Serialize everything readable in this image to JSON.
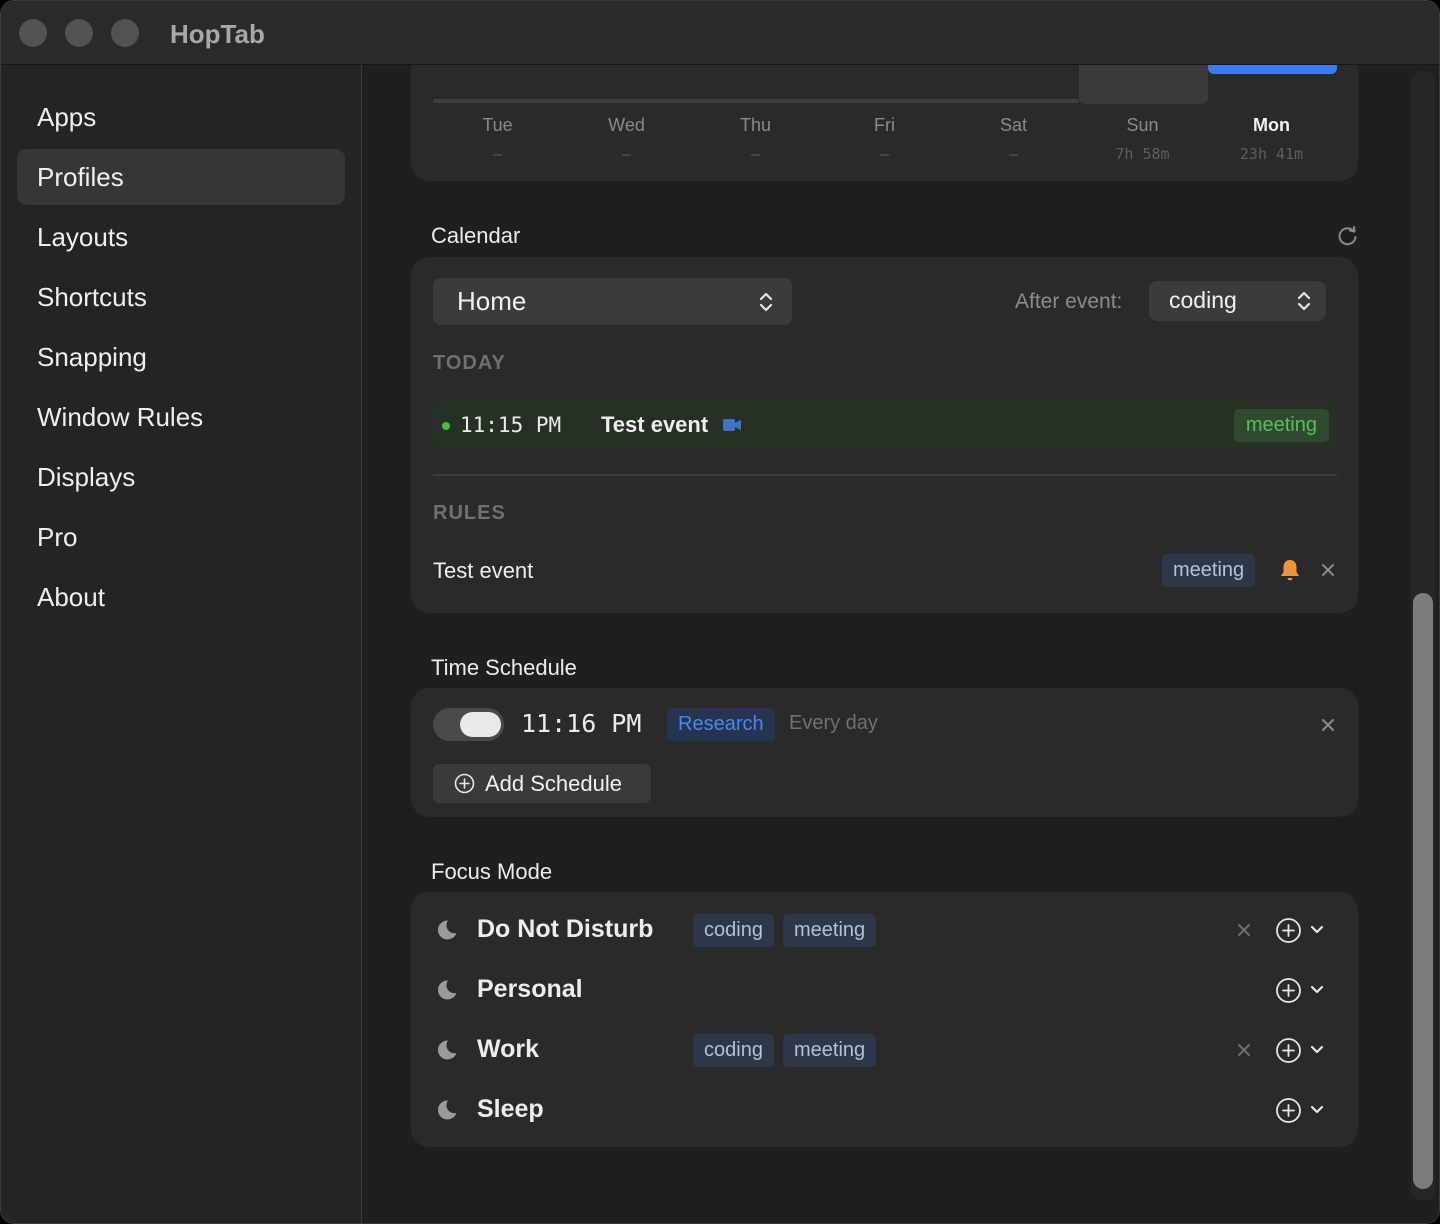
{
  "window": {
    "title": "HopTab"
  },
  "sidebar": {
    "items": [
      {
        "label": "Apps"
      },
      {
        "label": "Profiles",
        "selected": true
      },
      {
        "label": "Layouts"
      },
      {
        "label": "Shortcuts"
      },
      {
        "label": "Snapping"
      },
      {
        "label": "Window Rules"
      },
      {
        "label": "Displays"
      },
      {
        "label": "Pro"
      },
      {
        "label": "About"
      }
    ]
  },
  "usage": {
    "days": [
      {
        "day": "Tue",
        "duration": "–"
      },
      {
        "day": "Wed",
        "duration": "–"
      },
      {
        "day": "Thu",
        "duration": "–"
      },
      {
        "day": "Fri",
        "duration": "–"
      },
      {
        "day": "Sat",
        "duration": "–"
      },
      {
        "day": "Sun",
        "duration": "7h 58m"
      },
      {
        "day": "Mon",
        "duration": "23h 41m",
        "today": true
      }
    ],
    "colors": {
      "today": "#3b7bf6",
      "other": "#3a3a3a"
    }
  },
  "calendar": {
    "title": "Calendar",
    "selected_calendar": "Home",
    "after_event_label": "After event:",
    "after_event_value": "coding",
    "today_heading": "TODAY",
    "today_event": {
      "time": "11:15 PM",
      "title": "Test event",
      "tag": "meeting"
    },
    "rules_heading": "RULES",
    "rule": {
      "name": "Test event",
      "tag": "meeting"
    }
  },
  "schedule": {
    "title": "Time Schedule",
    "entry": {
      "time": "11:16 PM",
      "profile": "Research",
      "repeat": "Every day",
      "enabled": true
    },
    "add_label": "Add Schedule"
  },
  "focus": {
    "title": "Focus Mode",
    "modes": [
      {
        "name": "Do Not Disturb",
        "tags": [
          "coding",
          "meeting"
        ]
      },
      {
        "name": "Personal",
        "tags": []
      },
      {
        "name": "Work",
        "tags": [
          "coding",
          "meeting"
        ]
      },
      {
        "name": "Sleep",
        "tags": []
      }
    ]
  },
  "accent": {
    "blue": "#3b7bf6",
    "green": "#3ec04a",
    "orange": "#f0943a"
  }
}
